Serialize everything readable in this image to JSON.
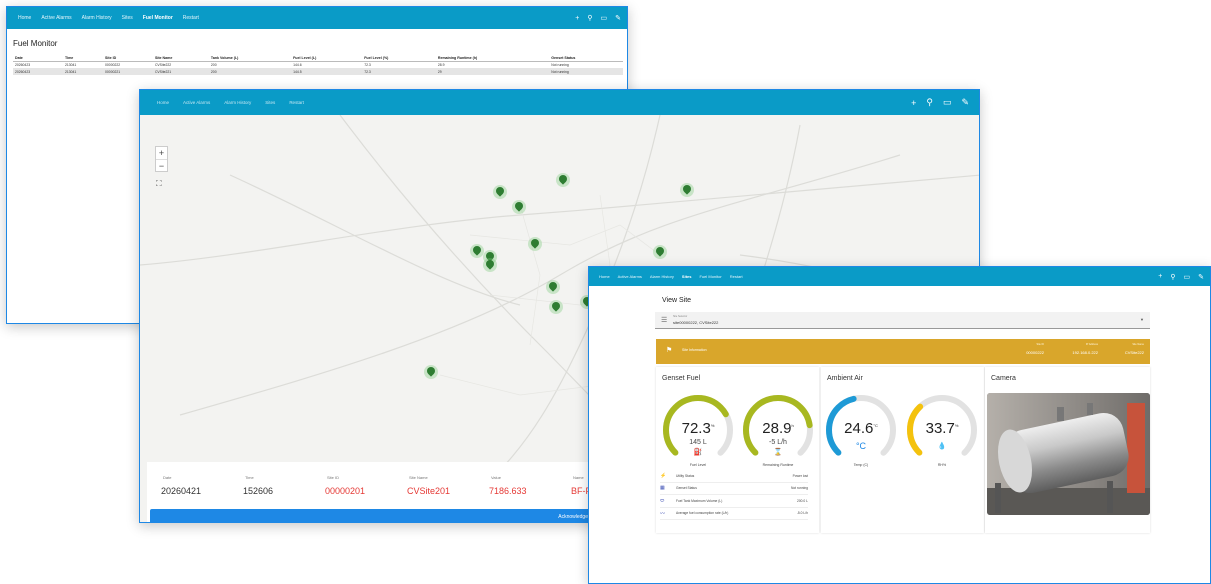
{
  "nav": {
    "home": "Home",
    "active_alarms": "Active Alarms",
    "alarm_history": "Alarm History",
    "sites": "Sites",
    "fuel_monitor": "Fuel Monitor",
    "restart": "Restart"
  },
  "fuel_monitor": {
    "title": "Fuel Monitor",
    "columns": [
      "Date",
      "Time",
      "Site ID",
      "Site Name",
      "Tank Volume (L)",
      "Fuel Level (L)",
      "Fuel Level (%)",
      "Remaining Runtime (h)",
      "Genset Status"
    ],
    "rows": [
      [
        "20260423",
        "213041",
        "00000222",
        "CVSite222",
        "200",
        "144.6",
        "72.3",
        "28.9",
        "Not running"
      ],
      [
        "20260423",
        "213041",
        "00000221",
        "CVSite221",
        "200",
        "144.5",
        "72.3",
        "29",
        "Not running"
      ]
    ]
  },
  "map_window": {
    "nav": [
      "Home",
      "Active Alarms",
      "Alarm History",
      "Sites",
      "Restart"
    ],
    "zoom_in": "+",
    "zoom_out": "−",
    "alarm": {
      "headers": [
        "Date",
        "Time",
        "Site ID",
        "Site Name",
        "Value",
        "Name"
      ],
      "values": [
        "20260421",
        "152606",
        "00000201",
        "CVSite201",
        "7186.633",
        "BF-FWD"
      ],
      "acknowledge": "Acknowledge"
    }
  },
  "view_site": {
    "title": "View Site",
    "selector_label": "Site Selector",
    "selector_value": "site00000222, CVSite222",
    "info_label": "Site Information",
    "info": [
      {
        "k": "Site ID",
        "v": "00000222"
      },
      {
        "k": "IP Address",
        "v": "192.168.0.222"
      },
      {
        "k": "Site Name",
        "v": "CVSite222"
      }
    ],
    "genset_fuel": "Genset Fuel",
    "ambient_air": "Ambient Air",
    "camera": "Camera",
    "gauges": {
      "fuel_level": {
        "value": "72.3",
        "unit": "%",
        "sub": "145 L",
        "label": "Fuel Level",
        "level": 0.723,
        "color": "#a8b820"
      },
      "runtime": {
        "value": "28.9",
        "unit": "h",
        "sub": "-5 L/h",
        "label": "Remaining Runtime",
        "level": 0.8,
        "color": "#a8b820"
      },
      "temp": {
        "value": "24.6",
        "unit": "°C",
        "sub": "°C",
        "label": "Temp (C)",
        "level": 0.45,
        "color": "#1e9ad6"
      },
      "rh": {
        "value": "33.7",
        "unit": "%",
        "sub": "",
        "label": "RH%",
        "level": 0.34,
        "color": "#f4c20d"
      }
    },
    "status": [
      {
        "k": "Utility Status",
        "v": "Power lost"
      },
      {
        "k": "Genset Status",
        "v": "Not running"
      },
      {
        "k": "Fuel Tank Maximum Volume (L)",
        "v": "200.0 L"
      },
      {
        "k": "Average fuel consumption rate (L/h)",
        "v": "-5.0 L/h"
      }
    ]
  }
}
